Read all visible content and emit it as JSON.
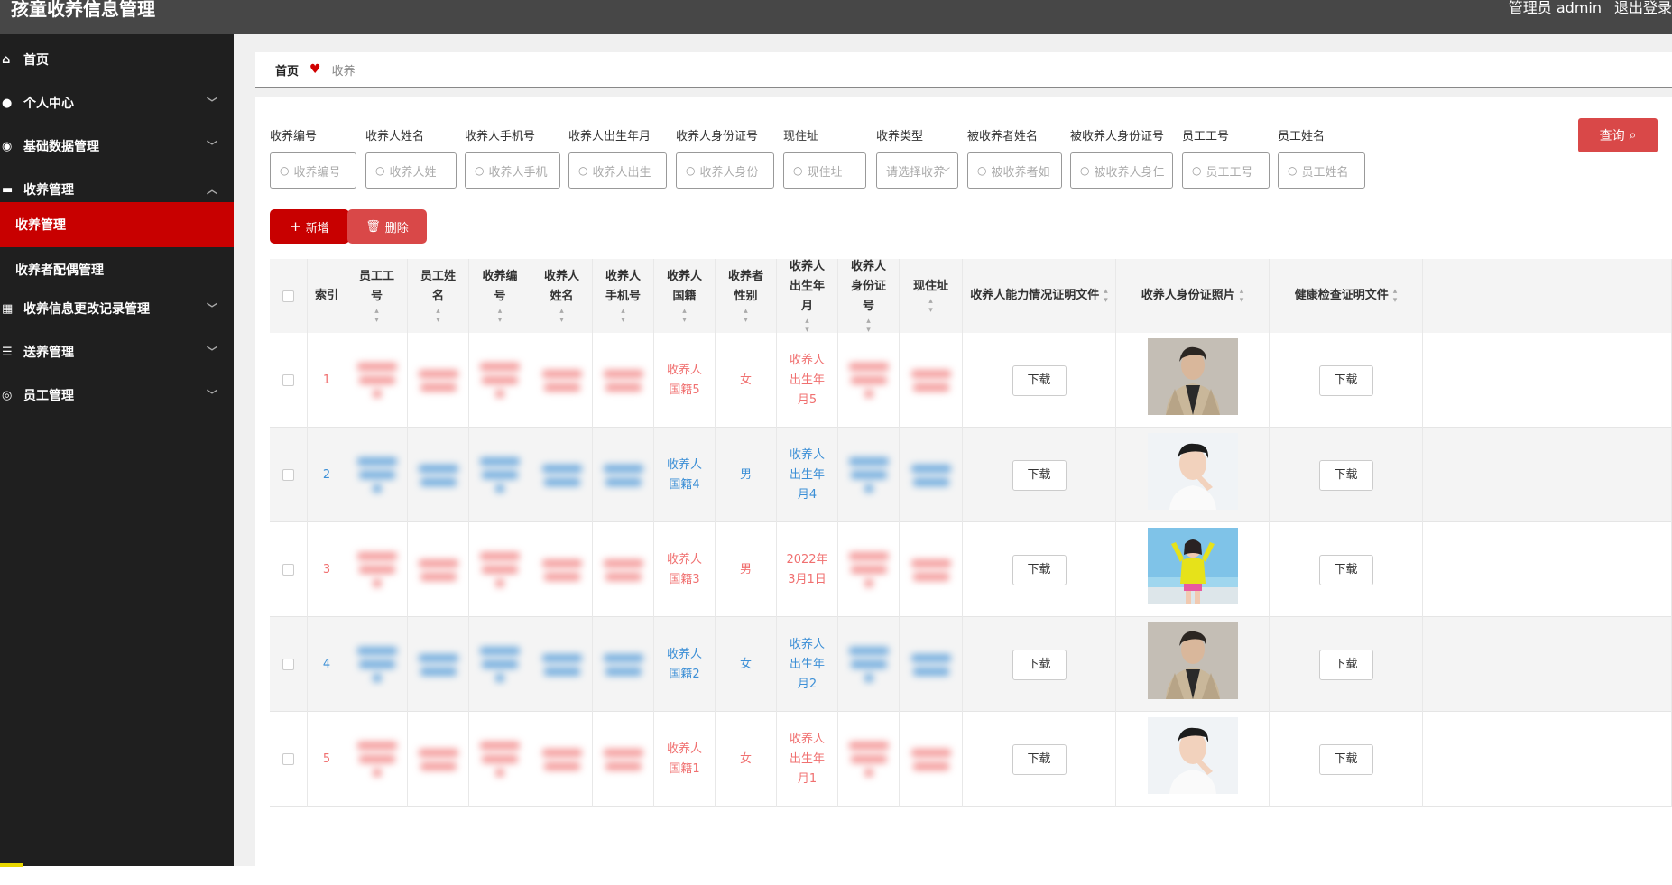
{
  "header": {
    "title": "孩童收养信息管理",
    "admin": "管理员 admin",
    "logout": "退出登录"
  },
  "sidebar": {
    "items": [
      {
        "label": "首页",
        "icon": "home-icon",
        "chevron": ""
      },
      {
        "label": "个人中心",
        "icon": "user-icon",
        "chevron": "﹀"
      },
      {
        "label": "基础数据管理",
        "icon": "location-icon",
        "chevron": "﹀"
      },
      {
        "label": "收养管理",
        "icon": "chat-icon",
        "chevron": "︿"
      },
      {
        "label": "收养信息更改记录管理",
        "icon": "grid-icon",
        "chevron": "﹀"
      },
      {
        "label": "送养管理",
        "icon": "sliders-icon",
        "chevron": "﹀"
      },
      {
        "label": "员工管理",
        "icon": "compass-icon",
        "chevron": "﹀"
      }
    ],
    "subitems": [
      {
        "label": "收养管理",
        "active": true
      },
      {
        "label": "收养者配偶管理",
        "active": false
      }
    ],
    "accent_color": "#c80000"
  },
  "breadcrumb": {
    "home": "首页",
    "current": "收养"
  },
  "search": {
    "fields": [
      {
        "label": "收养编号",
        "placeholder": "收养编号"
      },
      {
        "label": "收养人姓名",
        "placeholder": "收养人姓"
      },
      {
        "label": "收养人手机号",
        "placeholder": "收养人手机"
      },
      {
        "label": "收养人出生年月",
        "placeholder": "收养人出生"
      },
      {
        "label": "收养人身份证号",
        "placeholder": "收养人身份"
      },
      {
        "label": "现住址",
        "placeholder": "现住址"
      },
      {
        "label": "收养类型",
        "placeholder": "请选择收养"
      },
      {
        "label": "被收养者姓名",
        "placeholder": "被收养者如"
      },
      {
        "label": "被收养人身份证号",
        "placeholder": "被收养人身仁"
      },
      {
        "label": "员工工号",
        "placeholder": "员工工号"
      },
      {
        "label": "员工姓名",
        "placeholder": "员工姓名"
      }
    ],
    "query_label": "查询"
  },
  "actions": {
    "add_label": "新增",
    "delete_label": "删除"
  },
  "table": {
    "headers": [
      {
        "label": "索引"
      },
      {
        "label": "员工工号"
      },
      {
        "label": "员工姓名"
      },
      {
        "label": "收养编号"
      },
      {
        "label": "收养人姓名"
      },
      {
        "label": "收养人手机号"
      },
      {
        "label": "收养人国籍"
      },
      {
        "label": "收养者性别"
      },
      {
        "label": "收养人出生年月"
      },
      {
        "label": "收养人身份证号"
      },
      {
        "label": "现住址"
      },
      {
        "label": "收养人能力情况证明文件"
      },
      {
        "label": "收养人身份证照片"
      },
      {
        "label": "健康检查证明文件"
      }
    ],
    "download_label": "下载",
    "rows": [
      {
        "index": "1",
        "nationality": "收养人国籍5",
        "gender": "女",
        "birth": "收养人出生年月5",
        "color": "red",
        "photo": "man-coat"
      },
      {
        "index": "2",
        "nationality": "收养人国籍4",
        "gender": "男",
        "birth": "收养人出生年月4",
        "color": "blue",
        "photo": "man-white"
      },
      {
        "index": "3",
        "nationality": "收养人国籍3",
        "gender": "男",
        "birth": "2022年3月1日",
        "color": "red",
        "photo": "woman-yellow"
      },
      {
        "index": "4",
        "nationality": "收养人国籍2",
        "gender": "女",
        "birth": "收养人出生年月2",
        "color": "blue",
        "photo": "man-coat"
      },
      {
        "index": "5",
        "nationality": "收养人国籍1",
        "gender": "女",
        "birth": "收养人出生年月1",
        "color": "red",
        "photo": "man-white"
      }
    ],
    "colors": {
      "red": "#f07070",
      "blue": "#3c8fd6"
    }
  }
}
